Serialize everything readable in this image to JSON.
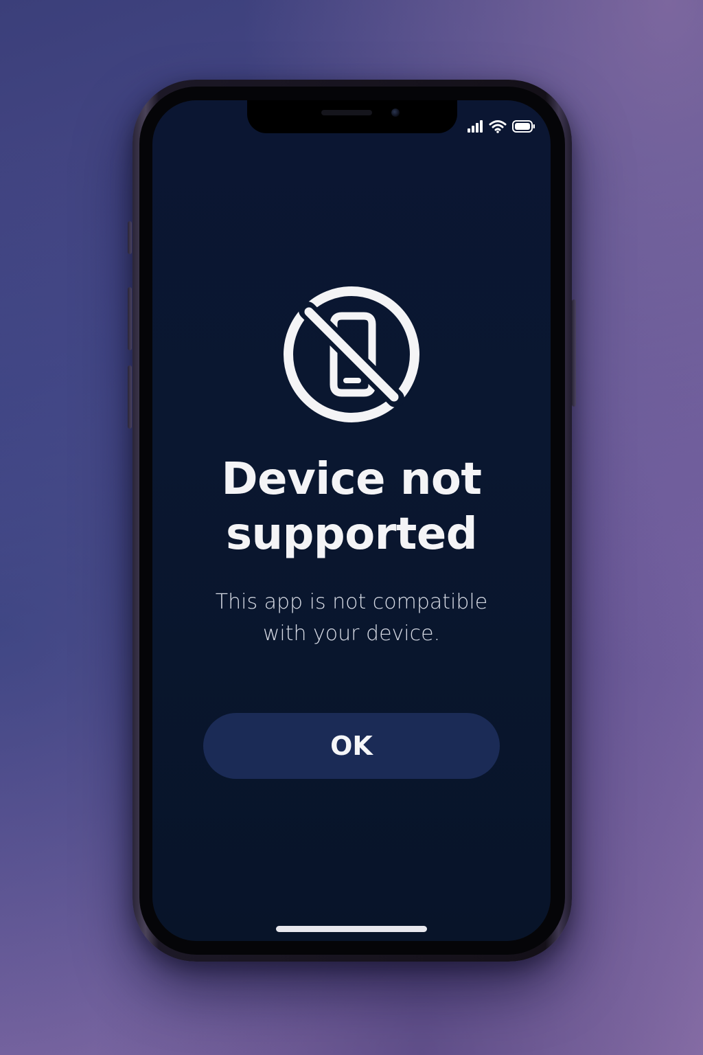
{
  "alert": {
    "icon": "device-not-supported-icon",
    "title_line1": "Device not",
    "title_line2": "supported",
    "message_line1": "This app is not compatible",
    "message_line2": "with your device.",
    "button_label": "OK"
  },
  "status_bar": {
    "icons": [
      "cellular-signal-icon",
      "wifi-icon",
      "battery-icon"
    ]
  },
  "colors": {
    "screen_background": "#0a1730",
    "button_background": "#1b2b56",
    "text_primary": "#f4f4f6",
    "page_background_accent": "#6a5a9a"
  }
}
